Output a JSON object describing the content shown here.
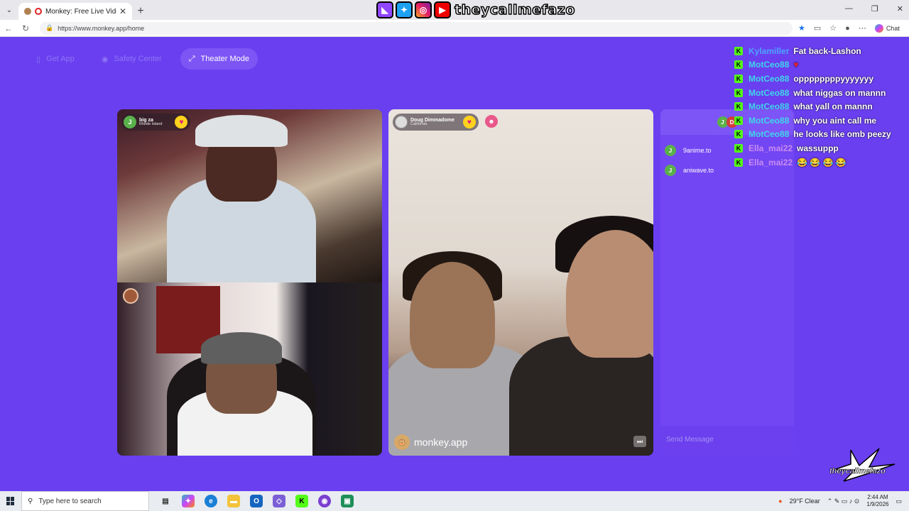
{
  "browser": {
    "tab_title": "Monkey: Free Live Video Chat",
    "url": "https://www.monkey.app/home",
    "chat_label": "Chat"
  },
  "banner": {
    "handle": "theycallmefazo",
    "socials": [
      "twitch-icon",
      "twitter-icon",
      "instagram-icon",
      "youtube-icon"
    ]
  },
  "nav": {
    "items": [
      {
        "label": "Get App",
        "icon": "phone-icon"
      },
      {
        "label": "Safety Center",
        "icon": "shield-icon"
      },
      {
        "label": "Theater Mode",
        "icon": "expand-icon"
      }
    ]
  },
  "tiles": {
    "top_left": {
      "initial": "J",
      "name": "big za",
      "location": "Rhode Island"
    },
    "right": {
      "name": "Doug Dimmadome",
      "location": "California",
      "watermark": "monkey.app"
    }
  },
  "chat_panel": {
    "header_initials": [
      "J",
      "D"
    ],
    "participants": [
      {
        "initial": "J",
        "name": "9anime.to"
      },
      {
        "initial": "J",
        "name": "aniwave.to"
      }
    ],
    "send_placeholder": "Send Message"
  },
  "overlay_chat": [
    {
      "user": "Kylamiller",
      "text": "Fat back-Lashon",
      "color": "#4fa3ff"
    },
    {
      "user": "MotCeo88",
      "text": "♥",
      "color": "#40d6e8"
    },
    {
      "user": "MotCeo88",
      "text": "oppppppppyyyyyyy",
      "color": "#40d6e8"
    },
    {
      "user": "MotCeo88",
      "text": "what niggas on mannn",
      "color": "#40d6e8"
    },
    {
      "user": "MotCeo88",
      "text": "what yall on mannn",
      "color": "#40d6e8"
    },
    {
      "user": "MotCeo88",
      "text": "why you aint call me",
      "color": "#40d6e8"
    },
    {
      "user": "MotCeo88",
      "text": "he looks like omb peezy",
      "color": "#40d6e8"
    },
    {
      "user": "Ella_mai22",
      "text": "wassuppp",
      "color": "#c98bf2"
    },
    {
      "user": "Ella_mai22",
      "text": "😂 😂 😂 😂",
      "color": "#c98bf2"
    }
  ],
  "bottom_logo": "theycallmefazo",
  "taskbar": {
    "search_placeholder": "Type here to search",
    "weather": "29°F  Clear",
    "time": "2:44 AM",
    "date": "1/9/2026"
  }
}
